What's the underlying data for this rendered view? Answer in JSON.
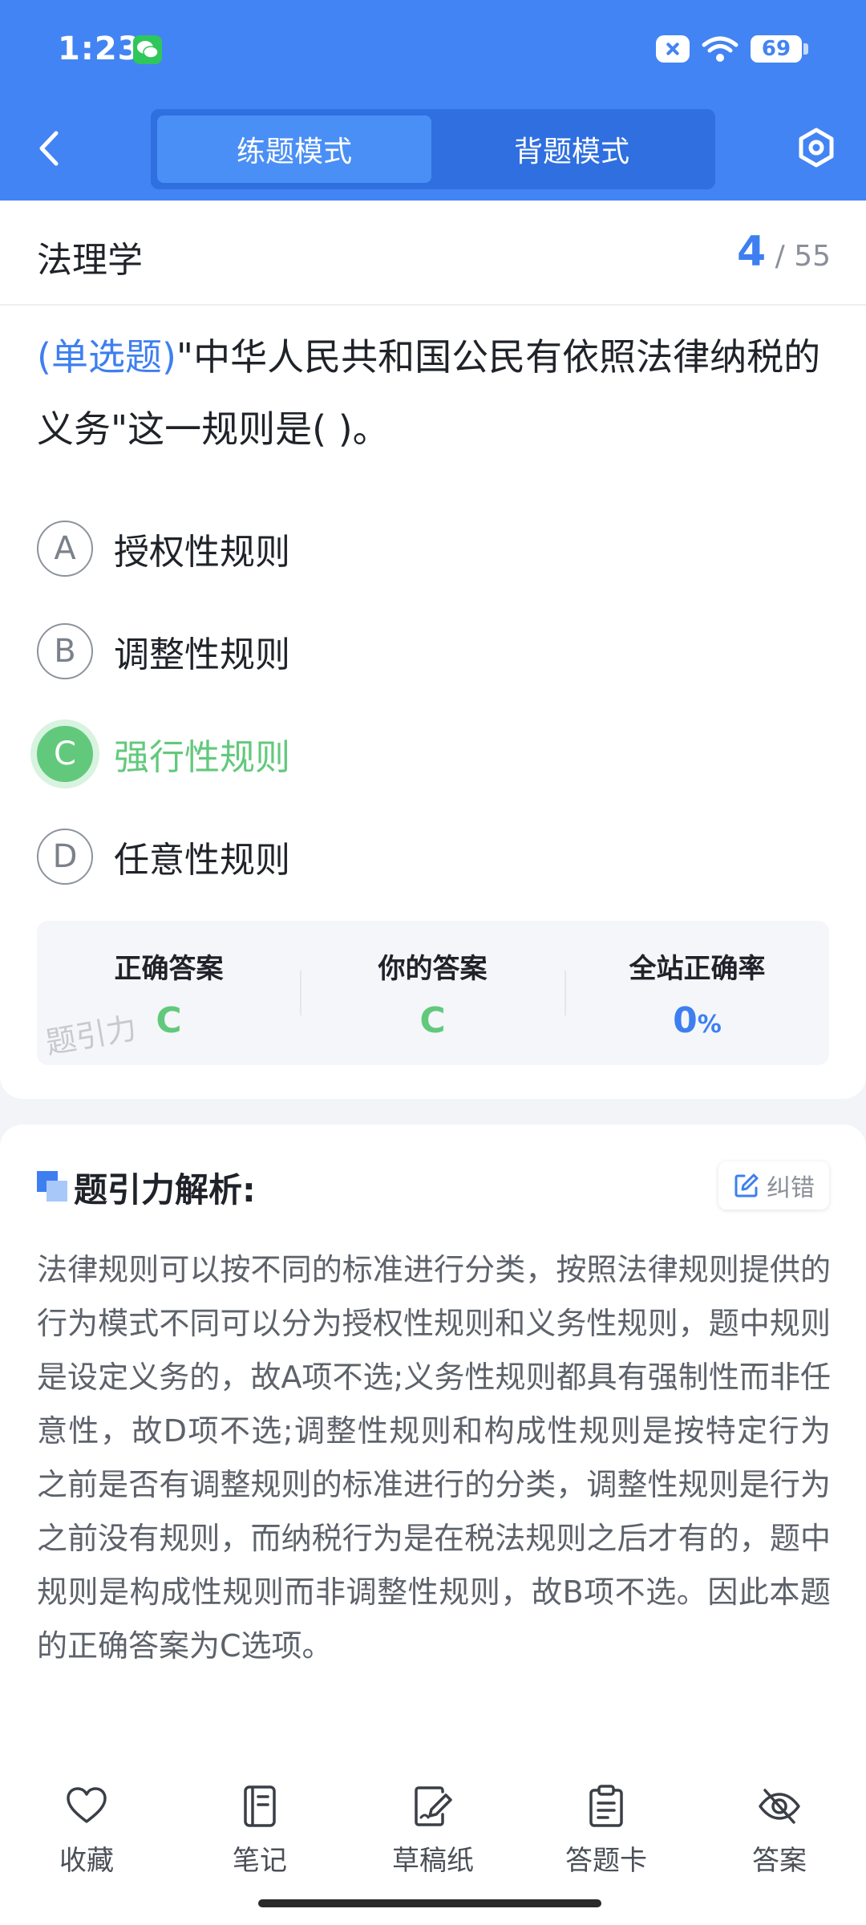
{
  "status_bar": {
    "time": "1:23",
    "battery": "69"
  },
  "mode_switch": {
    "tabs": [
      {
        "label": "练题模式",
        "active": true
      },
      {
        "label": "背题模式",
        "active": false
      }
    ]
  },
  "subject": {
    "title": "法理学",
    "current": "4",
    "separator": "/",
    "total": "55"
  },
  "question": {
    "type_label": "(单选题)",
    "text": "\"中华人民共和国公民有依照法律纳税的义务\"这一规则是(        )。"
  },
  "options": [
    {
      "letter": "A",
      "text": "授权性规则",
      "correct": false
    },
    {
      "letter": "B",
      "text": "调整性规则",
      "correct": false
    },
    {
      "letter": "C",
      "text": "强行性规则",
      "correct": true
    },
    {
      "letter": "D",
      "text": "任意性规则",
      "correct": false
    }
  ],
  "answer_summary": {
    "correct_label": "正确答案",
    "correct_value": "C",
    "yours_label": "你的答案",
    "yours_value": "C",
    "rate_label": "全站正确率",
    "rate_value": "0",
    "rate_unit": "%",
    "watermark": "题引力"
  },
  "analysis": {
    "title": "题引力解析:",
    "report_label": "纠错",
    "text": "法律规则可以按不同的标准进行分类，按照法律规则提供的行为模式不同可以分为授权性规则和义务性规则，题中规则是设定义务的，故A项不选;义务性规则都具有强制性而非任意性，故D项不选;调整性规则和构成性规则是按特定行为之前是否有调整规则的标准进行的分类，调整性规则是行为之前没有规则，而纳税行为是在税法规则之后才有的，题中规则是构成性规则而非调整性规则，故B项不选。因此本题的正确答案为C选项。"
  },
  "bottom_bar": {
    "items": [
      {
        "label": "收藏",
        "icon": "heart-icon"
      },
      {
        "label": "笔记",
        "icon": "notebook-icon"
      },
      {
        "label": "草稿纸",
        "icon": "draft-pen-icon"
      },
      {
        "label": "答题卡",
        "icon": "clipboard-icon"
      },
      {
        "label": "答案",
        "icon": "eye-off-icon"
      }
    ]
  },
  "colors": {
    "primary": "#4284f3",
    "correct": "#62c97c",
    "accent_text": "#3d7ff0"
  }
}
